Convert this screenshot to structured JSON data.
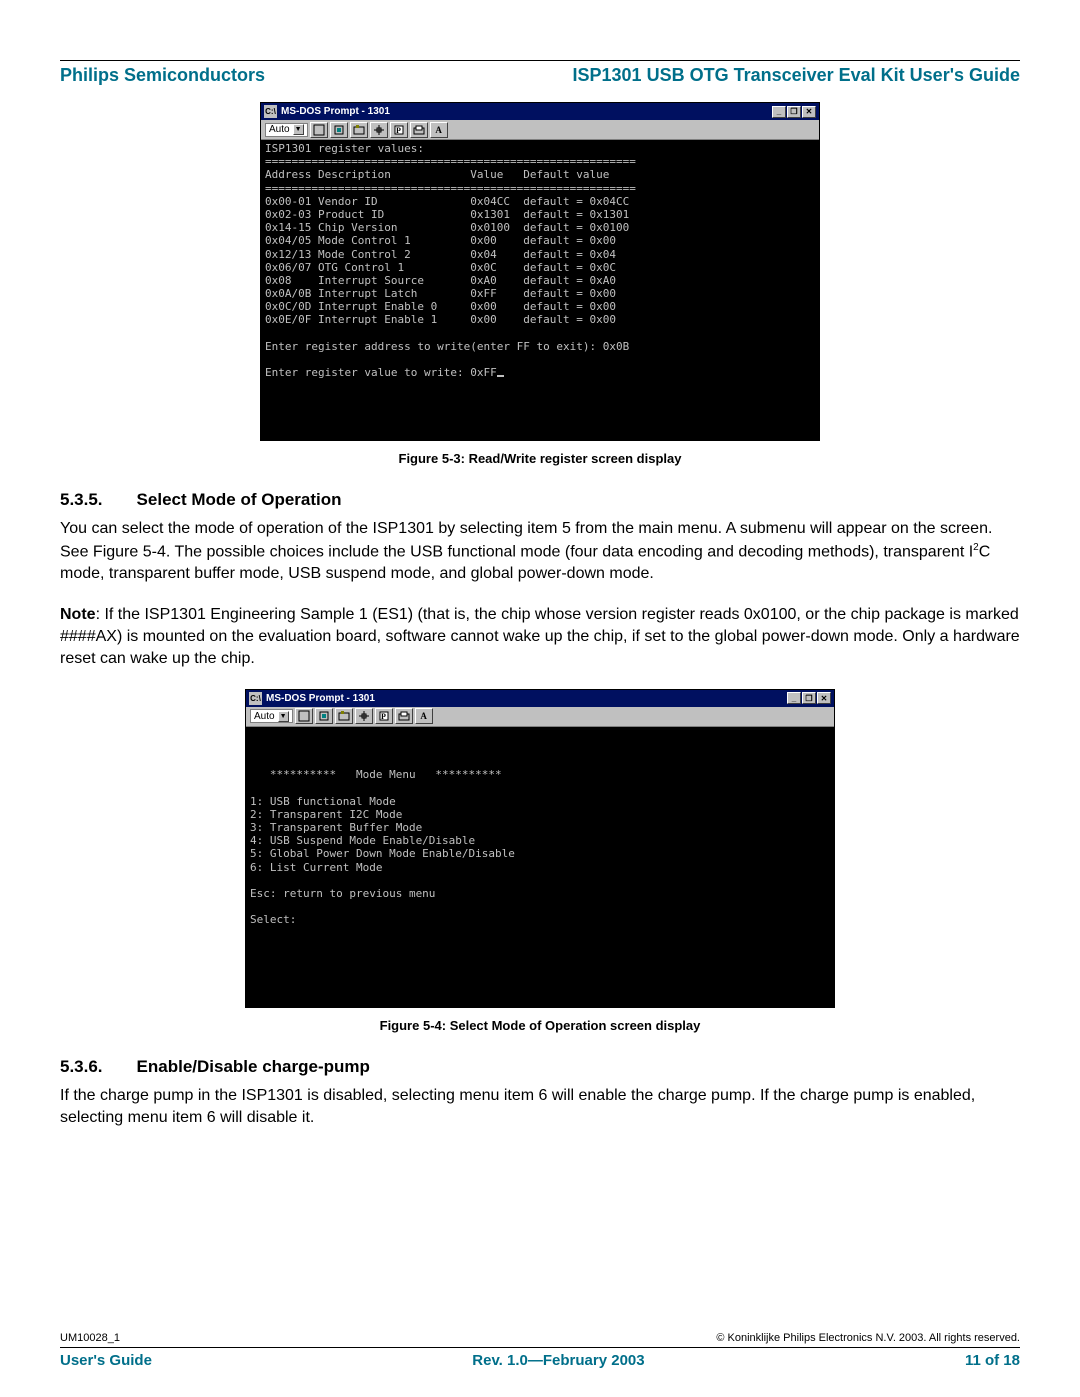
{
  "header": {
    "left": "Philips Semiconductors",
    "right": "ISP1301 USB OTG Transceiver Eval Kit User's Guide"
  },
  "doswin1": {
    "title": "MS-DOS Prompt - 1301",
    "combo": "Auto",
    "btn_a": "A",
    "body": "ISP1301 register values:\n========================================================\nAddress Description            Value   Default value\n========================================================\n0x00-01 Vendor ID              0x04CC  default = 0x04CC\n0x02-03 Product ID             0x1301  default = 0x1301\n0x14-15 Chip Version           0x0100  default = 0x0100\n0x04/05 Mode Control 1         0x00    default = 0x00\n0x12/13 Mode Control 2         0x04    default = 0x04\n0x06/07 OTG Control 1          0x0C    default = 0x0C\n0x08    Interrupt Source       0xA0    default = 0xA0\n0x0A/0B Interrupt Latch        0xFF    default = 0x00\n0x0C/0D Interrupt Enable 0     0x00    default = 0x00\n0x0E/0F Interrupt Enable 1     0x00    default = 0x00\n\nEnter register address to write(enter FF to exit): 0x0B\n\nEnter register value to write: 0xFF"
  },
  "fig1_caption": "Figure 5-3: Read/Write register screen display",
  "section535": {
    "num": "5.3.5.",
    "title": "Select Mode of Operation",
    "para1_html": "You can select the mode of operation of the ISP1301 by selecting item 5 from the main menu. A submenu will appear on the screen. See Figure 5-4. The possible choices include the USB functional mode (four data encoding and decoding methods), transparent I2C mode, transparent buffer mode, USB suspend mode, and global power-down mode.",
    "para2_pre": "Note",
    "para2_rest": ": If the ISP1301 Engineering Sample 1 (ES1) (that is, the chip whose version register reads 0x0100, or the chip package is marked ####AX) is mounted on the evaluation board, software cannot wake up the chip, if set to the global power-down mode. Only a hardware reset can wake up the chip."
  },
  "doswin2": {
    "title": "MS-DOS Prompt - 1301",
    "combo": "Auto",
    "btn_a": "A",
    "body": "\n\n\n   **********   Mode Menu   **********\n\n1: USB functional Mode\n2: Transparent I2C Mode\n3: Transparent Buffer Mode\n4: USB Suspend Mode Enable/Disable\n5: Global Power Down Mode Enable/Disable\n6: List Current Mode\n\nEsc: return to previous menu\n\nSelect:"
  },
  "fig2_caption": "Figure 5-4: Select Mode of Operation screen display",
  "section536": {
    "num": "5.3.6.",
    "title": "Enable/Disable charge-pump",
    "para": "If the charge pump in the ISP1301 is disabled, selecting menu item 6 will enable the charge pump. If the charge pump is enabled, selecting menu item 6 will disable it."
  },
  "footer": {
    "docid": "UM10028_1",
    "copyright": "© Koninklijke Philips Electronics N.V. 2003. All rights reserved.",
    "left": "User's Guide",
    "center": "Rev. 1.0—February 2003",
    "right": "11 of 18"
  },
  "icons": {
    "minimize": "_",
    "maximize": "❐",
    "close": "✕",
    "msdos": "C:\\",
    "arrow_down": "▼"
  }
}
